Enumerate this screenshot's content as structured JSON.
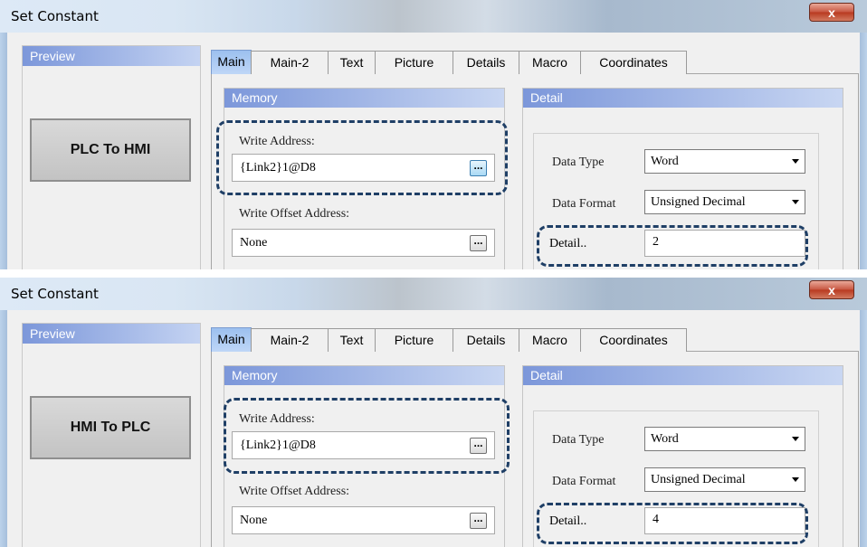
{
  "panels": [
    {
      "window_title": "Set Constant",
      "close_label": "x",
      "preview": {
        "header": "Preview",
        "button_label": "PLC To HMI"
      },
      "tabs": [
        "Main",
        "Main-2",
        "Text",
        "Picture",
        "Details",
        "Macro",
        "Coordinates"
      ],
      "memory": {
        "header": "Memory",
        "write_address_label": "Write Address:",
        "write_address_value": "{Link2}1@D8",
        "write_offset_label": "Write Offset Address:",
        "write_offset_value": "None",
        "browse_label": "..."
      },
      "detail": {
        "header": "Detail",
        "data_type_label": "Data Type",
        "data_type_value": "Word",
        "data_format_label": "Data Format",
        "data_format_value": "Unsigned Decimal",
        "detail_label": "Detail..",
        "detail_value": "2"
      }
    },
    {
      "window_title": "Set Constant",
      "close_label": "x",
      "preview": {
        "header": "Preview",
        "button_label": "HMI To PLC"
      },
      "tabs": [
        "Main",
        "Main-2",
        "Text",
        "Picture",
        "Details",
        "Macro",
        "Coordinates"
      ],
      "memory": {
        "header": "Memory",
        "write_address_label": "Write Address:",
        "write_address_value": "{Link2}1@D8",
        "write_offset_label": "Write Offset Address:",
        "write_offset_value": "None",
        "browse_label": "..."
      },
      "detail": {
        "header": "Detail",
        "data_type_label": "Data Type",
        "data_type_value": "Word",
        "data_format_label": "Data Format",
        "data_format_value": "Unsigned Decimal",
        "detail_label": "Detail..",
        "detail_value": "4"
      }
    }
  ],
  "colors": {
    "highlight_dash": "#1f3f66",
    "group_header": "#7c97da",
    "active_tab": "#9cc0ef",
    "close_button": "#c75540"
  }
}
